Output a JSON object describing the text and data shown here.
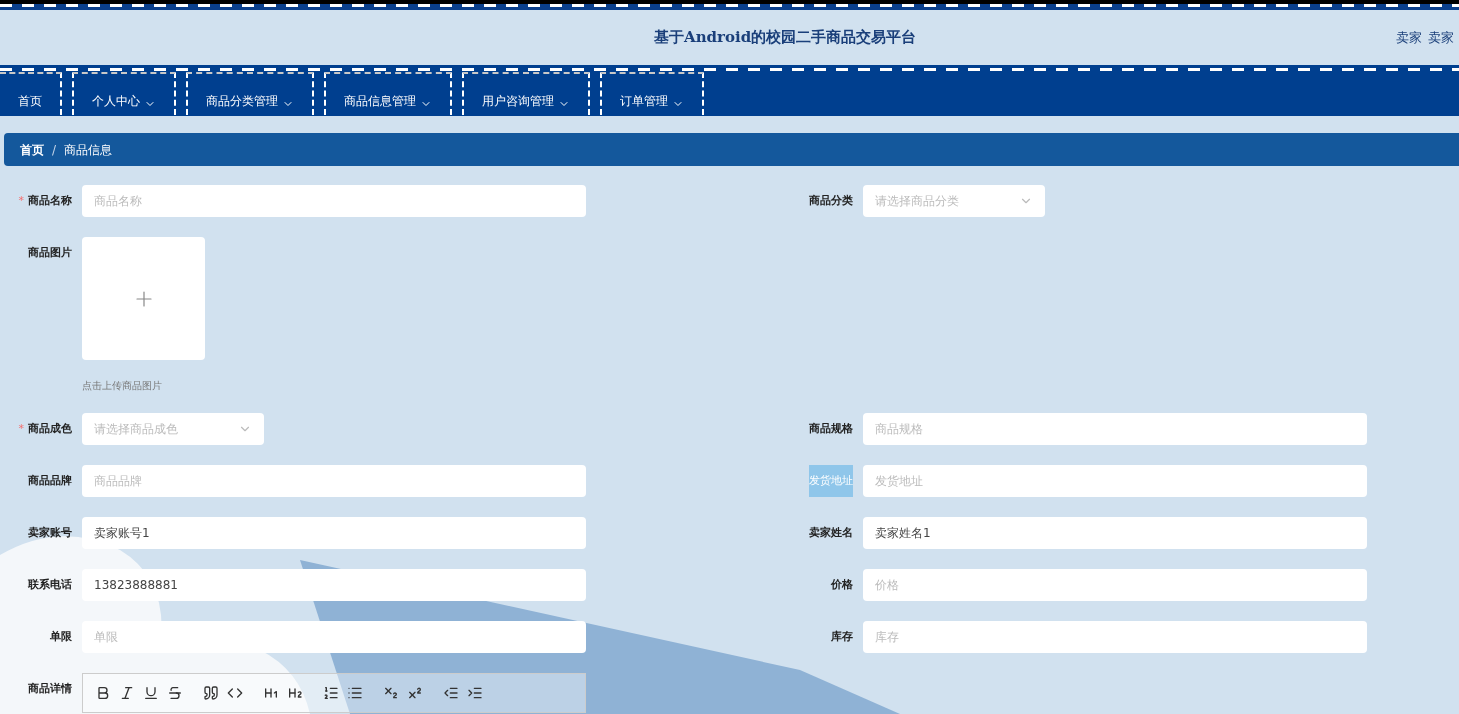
{
  "header": {
    "title": "基于Android的校园二手商品交易平台",
    "user_links": [
      "卖家",
      "卖家"
    ]
  },
  "nav": [
    {
      "label": "首页",
      "has_menu": false
    },
    {
      "label": "个人中心",
      "has_menu": true
    },
    {
      "label": "商品分类管理",
      "has_menu": true
    },
    {
      "label": "商品信息管理",
      "has_menu": true
    },
    {
      "label": "用户咨询管理",
      "has_menu": true
    },
    {
      "label": "订单管理",
      "has_menu": true
    }
  ],
  "breadcrumb": {
    "separator": "/",
    "items": [
      "首页",
      "商品信息"
    ]
  },
  "form": {
    "rows": [
      {
        "left": {
          "kind": "input",
          "label": "商品名称",
          "required_mark": "*",
          "placeholder": "商品名称"
        },
        "right": {
          "kind": "select",
          "label": "商品分类",
          "highlighted": false,
          "placeholder": "请选择商品分类"
        }
      },
      {
        "left": {
          "kind": "upload",
          "label": "商品图片",
          "hint": "点击上传商品图片"
        }
      },
      {
        "left": {
          "kind": "select",
          "label": "商品成色",
          "required_mark": "*",
          "placeholder": "请选择商品成色"
        },
        "right": {
          "kind": "input",
          "label": "商品规格",
          "highlighted": false,
          "placeholder": "商品规格"
        }
      },
      {
        "left": {
          "kind": "input",
          "label": "商品品牌",
          "placeholder": "商品品牌"
        },
        "right": {
          "kind": "input",
          "label": "发货地址",
          "highlighted": true,
          "placeholder": "发货地址"
        }
      },
      {
        "left": {
          "kind": "input",
          "label": "卖家账号",
          "value": "卖家账号1"
        },
        "right": {
          "kind": "input",
          "label": "卖家姓名",
          "highlighted": false,
          "value": "卖家姓名1"
        }
      },
      {
        "left": {
          "kind": "input",
          "label": "联系电话",
          "value": "13823888881"
        },
        "right": {
          "kind": "input",
          "label": "价格",
          "highlighted": false,
          "placeholder": "价格"
        }
      },
      {
        "left": {
          "kind": "input",
          "label": "单限",
          "placeholder": "单限"
        },
        "right": {
          "kind": "input",
          "label": "库存",
          "highlighted": false,
          "placeholder": "库存"
        }
      },
      {
        "left": {
          "kind": "editor",
          "label": "商品详情"
        }
      }
    ]
  }
}
